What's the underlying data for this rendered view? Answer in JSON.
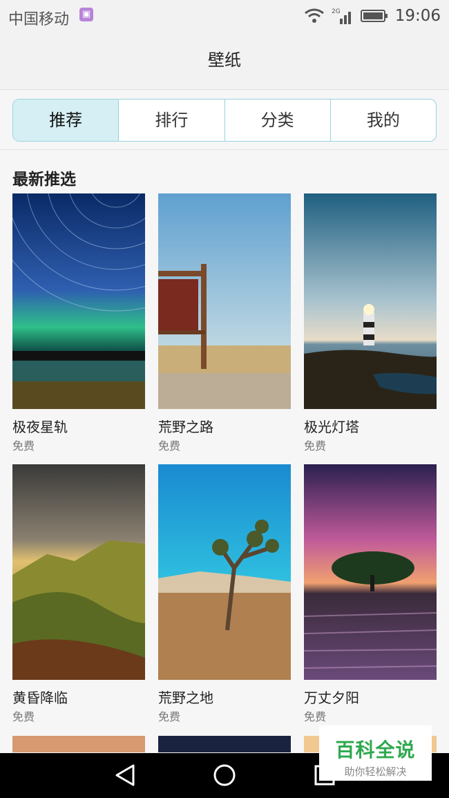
{
  "status": {
    "carrier": "中国移动",
    "network": "2G",
    "time": "19:06"
  },
  "header": {
    "title": "壁纸"
  },
  "tabs": [
    {
      "label": "推荐",
      "selected": true
    },
    {
      "label": "排行",
      "selected": false
    },
    {
      "label": "分类",
      "selected": false
    },
    {
      "label": "我的",
      "selected": false
    }
  ],
  "section": {
    "title": "最新推选"
  },
  "wallpapers": [
    {
      "name": "极夜星轨",
      "price": "免费"
    },
    {
      "name": "荒野之路",
      "price": "免费"
    },
    {
      "name": "极光灯塔",
      "price": "免费"
    },
    {
      "name": "黄昏降临",
      "price": "免费"
    },
    {
      "name": "荒野之地",
      "price": "免费"
    },
    {
      "name": "万丈夕阳",
      "price": "免费"
    }
  ],
  "watermark": {
    "line1": "百科全说",
    "line2": "助你轻松解决"
  },
  "colors": {
    "accent": "#9ad3df",
    "selected_tab_bg": "#d6eff4",
    "watermark_green": "#2fa84f"
  }
}
